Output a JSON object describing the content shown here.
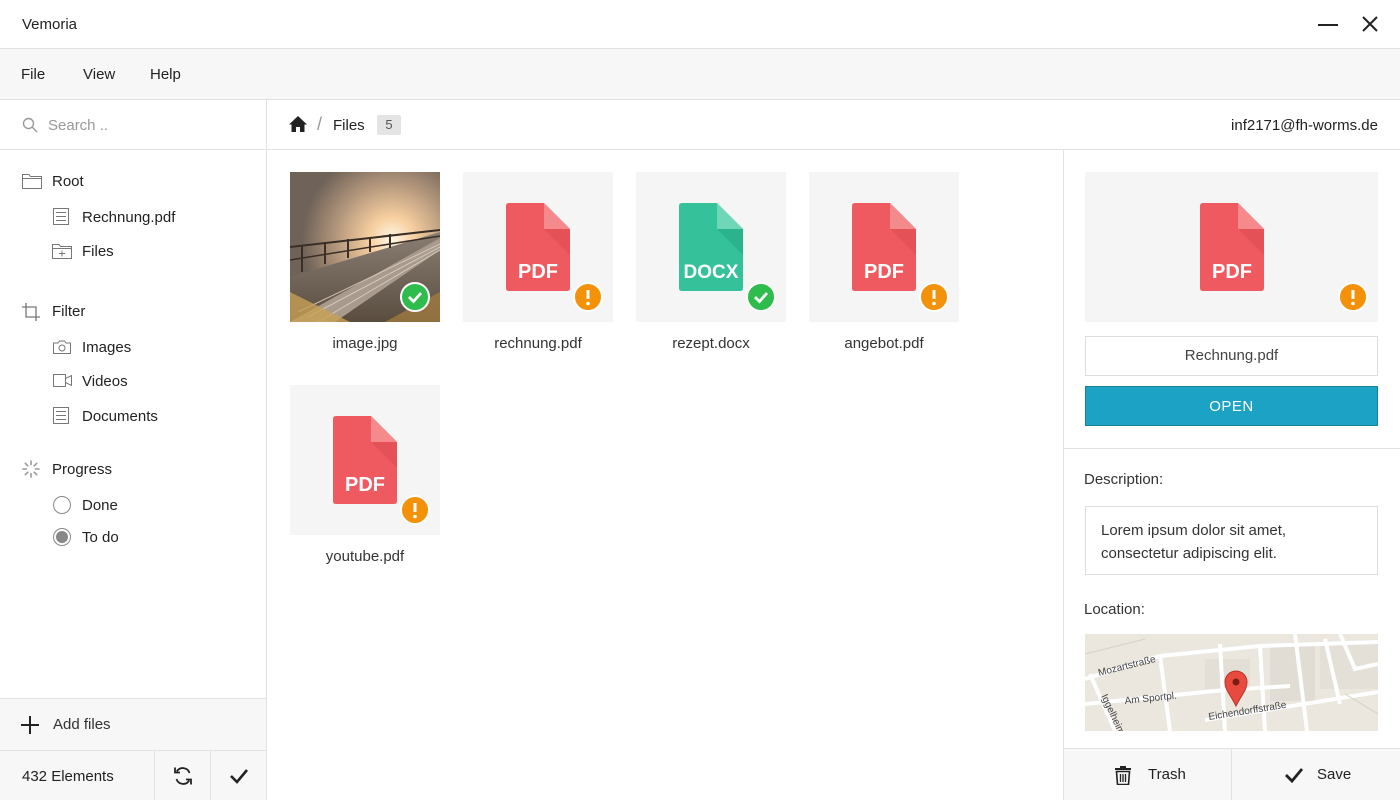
{
  "app": {
    "title": "Vemoria"
  },
  "menu": {
    "file": "File",
    "view": "View",
    "help": "Help"
  },
  "search": {
    "placeholder": "Search .."
  },
  "sidebar": {
    "root": {
      "label": "Root",
      "children": [
        "Rechnung.pdf",
        "Files"
      ]
    },
    "filter": {
      "label": "Filter",
      "children": [
        "Images",
        "Videos",
        "Documents"
      ]
    },
    "progress": {
      "label": "Progress",
      "options": [
        {
          "label": "Done",
          "checked": false
        },
        {
          "label": "To do",
          "checked": true
        }
      ]
    },
    "add_files": "Add files",
    "element_count": "432 Elements"
  },
  "breadcrumb": {
    "current": "Files",
    "count": "5"
  },
  "user": {
    "email": "inf2171@fh-worms.de"
  },
  "files": [
    {
      "name": "image.jpg",
      "type": "image",
      "status": "ok"
    },
    {
      "name": "rechnung.pdf",
      "type": "PDF",
      "status": "warn"
    },
    {
      "name": "rezept.docx",
      "type": "DOCX",
      "status": "ok"
    },
    {
      "name": "angebot.pdf",
      "type": "PDF",
      "status": "warn"
    },
    {
      "name": "youtube.pdf",
      "type": "PDF",
      "status": "warn"
    }
  ],
  "detail": {
    "preview_type": "PDF",
    "filename": "Rechnung.pdf",
    "open_label": "OPEN",
    "description_label": "Description:",
    "description": "Lorem ipsum dolor sit amet, consectetur adipiscing elit.",
    "location_label": "Location:",
    "map_streets": [
      "Mozartstraße",
      "Am Sportpl.",
      "Eichendorffstraße",
      "Iggelheimer"
    ],
    "trash_label": "Trash",
    "save_label": "Save"
  },
  "colors": {
    "pdf": "#ee5a5f",
    "docx": "#35c19a",
    "ok": "#2ebd4d",
    "warn": "#f39209",
    "accent": "#1ca2c5"
  }
}
